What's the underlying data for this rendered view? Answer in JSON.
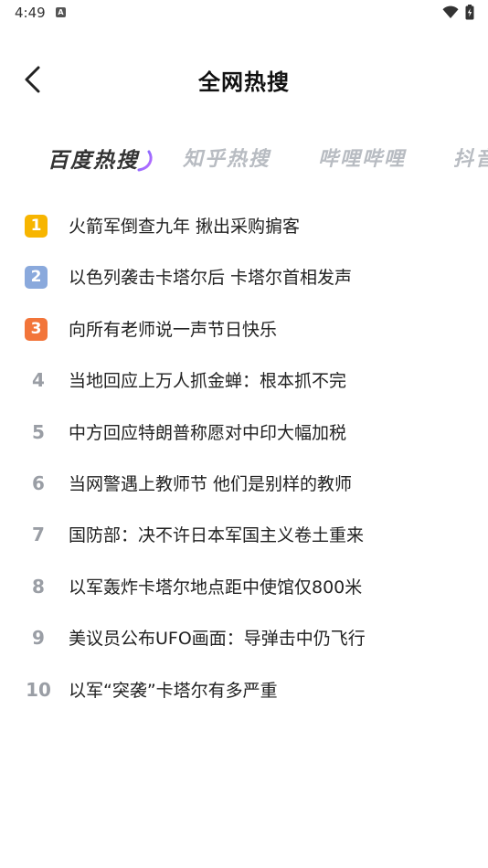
{
  "status_bar": {
    "time": "4:49",
    "notification_icon": "a-icon",
    "wifi_icon": "wifi-icon",
    "battery_icon": "battery-charging-icon"
  },
  "header": {
    "back_icon": "chevron-left-icon",
    "title": "全网热搜"
  },
  "tabs": [
    {
      "label": "百度热搜",
      "active": true
    },
    {
      "label": "知乎热搜",
      "active": false
    },
    {
      "label": "哔哩哔哩",
      "active": false
    },
    {
      "label": "抖音",
      "active": false
    }
  ],
  "list": [
    {
      "rank": "1",
      "title": "火箭军倒查九年 揪出采购掮客",
      "badge_color": "#f7b500"
    },
    {
      "rank": "2",
      "title": "以色列袭击卡塔尔后 卡塔尔首相发声",
      "badge_color": "#8aa9dc"
    },
    {
      "rank": "3",
      "title": "向所有老师说一声节日快乐",
      "badge_color": "#f2753a"
    },
    {
      "rank": "4",
      "title": "当地回应上万人抓金蝉：根本抓不完"
    },
    {
      "rank": "5",
      "title": "中方回应特朗普称愿对中印大幅加税"
    },
    {
      "rank": "6",
      "title": "当网警遇上教师节 他们是别样的教师"
    },
    {
      "rank": "7",
      "title": "国防部：决不许日本军国主义卷土重来"
    },
    {
      "rank": "8",
      "title": "以军轰炸卡塔尔地点距中使馆仅800米"
    },
    {
      "rank": "9",
      "title": "美议员公布UFO画面：导弹击中仍飞行"
    },
    {
      "rank": "10",
      "title": "以军“突袭”卡塔尔有多严重"
    }
  ],
  "colors": {
    "accent_gradient": [
      "#6b6bff",
      "#c26bff"
    ],
    "rank_plain": "#9a9ea5",
    "tab_inactive": "#b8bcc2"
  }
}
